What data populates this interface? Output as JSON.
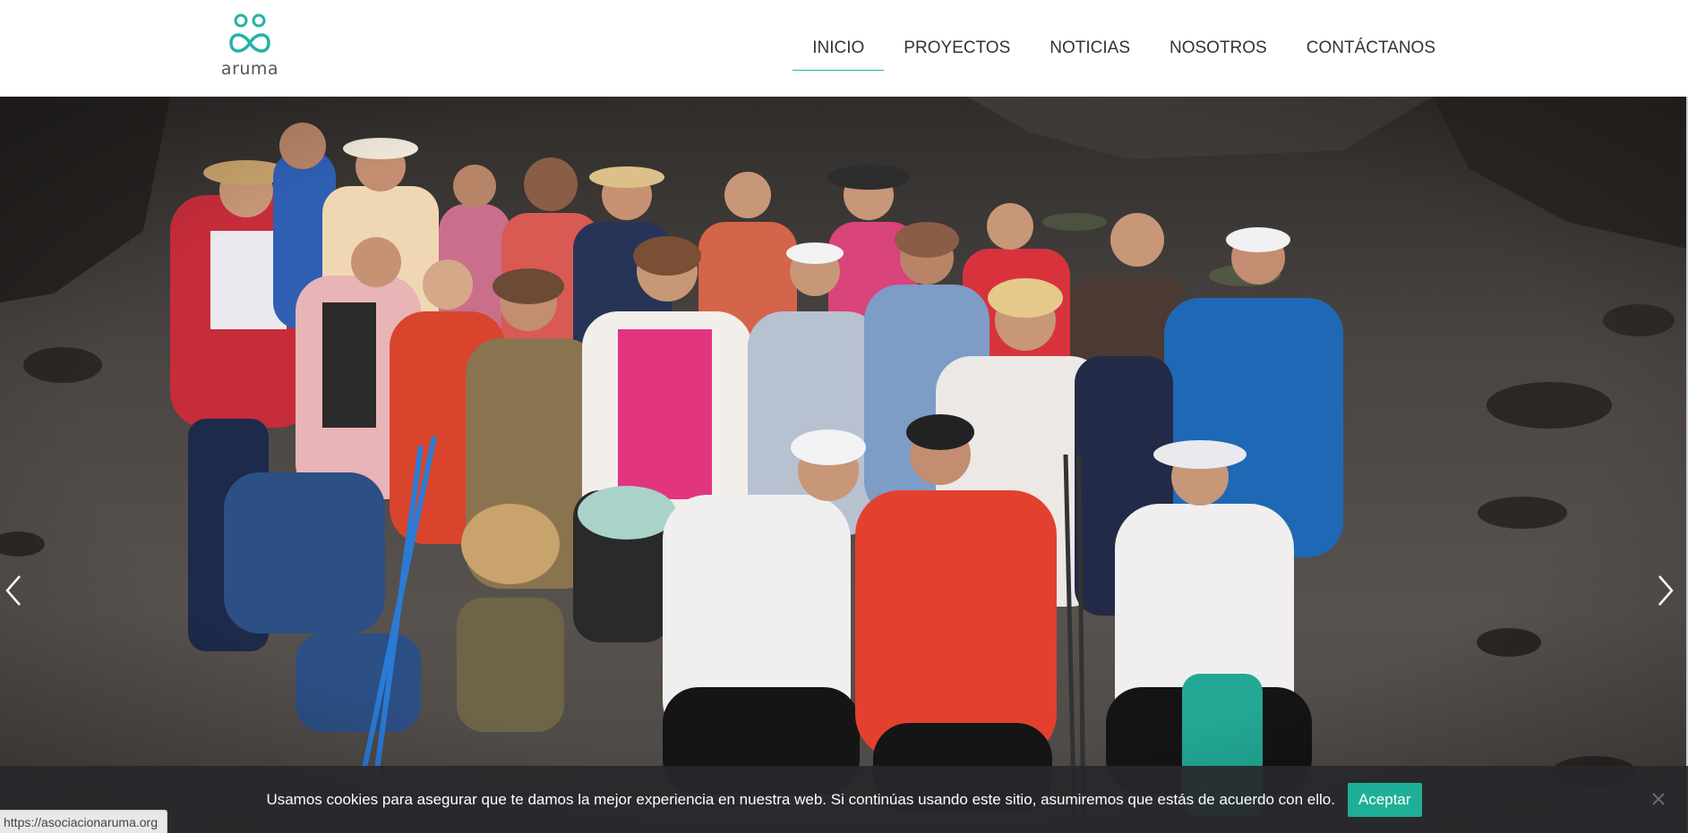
{
  "header": {
    "logo_text": "aruma",
    "brand_color": "#26b2a8",
    "nav": [
      {
        "label": "INICIO",
        "active": true
      },
      {
        "label": "PROYECTOS",
        "active": false
      },
      {
        "label": "NOTICIAS",
        "active": false
      },
      {
        "label": "NOSOTROS",
        "active": false
      },
      {
        "label": "CONTÁCTANOS",
        "active": false
      }
    ]
  },
  "hero": {
    "image_alt": "group-photo",
    "prev_icon": "chevron-left-icon",
    "next_icon": "chevron-right-icon"
  },
  "cookie_bar": {
    "message": "Usamos cookies para asegurar que te damos la mejor experiencia en nuestra web. Si continúas usando este sitio, asumiremos que estás de acuerdo con ello.",
    "accept_label": "Aceptar",
    "accept_color": "#1faf97",
    "close_icon": "close-icon"
  },
  "status_bar": {
    "url": "https://asociacionaruma.org"
  }
}
